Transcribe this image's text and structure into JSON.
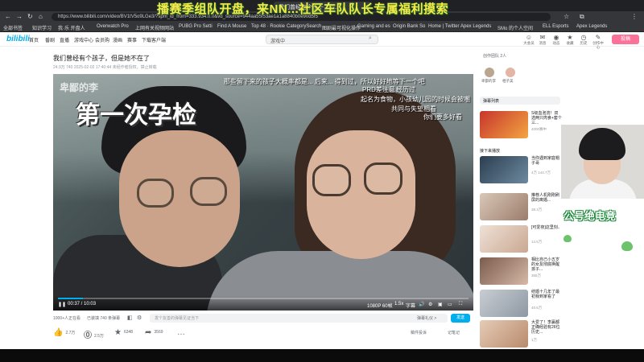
{
  "stream_banner": "播赛季组队开盘，来NN...社区车队队长专属福利摸索",
  "browser": {
    "tabs": [
      "",
      "",
      "",
      "我们曾经有个孩子，但..."
    ],
    "url": "https://www.bilibili.com/video/BV1tV5o9LGe3/?spm_id_from=333.934.0.0&vd_source=944aa55f53ae1a1a8840b0e90d5f5",
    "bookmarks": [
      "全部书签",
      "知识学习",
      "我·乐 开盘人",
      "Overwatch Pro",
      "上网有关视频网站",
      "PUBG Pro Setti",
      "Find A Mouse",
      "Top 48 · Rookie",
      "CategorySearch",
      "图剧最可视化操作",
      "Gaming and es",
      "Origin Bank So",
      "Home | Twitter",
      "Apex Legends",
      "SMo 的个人空间",
      "ELL Esports",
      "Apex Legends"
    ]
  },
  "site_header": {
    "logo": "bilibili",
    "nav": [
      "首页",
      "番剧",
      "直播",
      "游戏中心",
      "会员购",
      "漫画",
      "赛事",
      "下载客户端"
    ],
    "search_value": "游戏中",
    "icons": [
      {
        "glyph": "☺",
        "label": "大会员"
      },
      {
        "glyph": "✉",
        "label": "消息"
      },
      {
        "glyph": "◉",
        "label": "动态"
      },
      {
        "glyph": "★",
        "label": "收藏"
      },
      {
        "glyph": "◷",
        "label": "历史"
      },
      {
        "glyph": "✎",
        "label": "创作中心"
      }
    ],
    "upload_label": "投稿"
  },
  "video": {
    "title": "我们曾经有个孩子，但是她不在了",
    "meta": "24.9万  740  2025-02-02 17:40:44  未经作者授权，禁止转载",
    "caption": "第一次孕检",
    "brand": "卑鄙的李",
    "danmaku": [
      "那些留下来的孩子大概率都是... 后来... 得到过，所以好好地等下一个吧",
      "经历过",
      "PRD差注意",
      "起名为食物，小孩幼儿园的时候会被嘲",
      "共同与失望相看",
      "你们要多好看"
    ],
    "time": "00:37 / 10:03",
    "quality": "1080P 60帧",
    "speed": "1.5x",
    "subtitle_btn": "字幕",
    "progress_pct": 6
  },
  "danmaku_bar": {
    "viewers": "1000+人正在看",
    "loaded": "已装填 740 条弹幕",
    "placeholder": "发个友善的弹幕见证当下",
    "etiquette": "弹幕礼仪 >",
    "send": "发送"
  },
  "actions": {
    "like": "2.7万",
    "coin": "2.5万",
    "favorite": "6348",
    "share": "3569",
    "more": "…"
  },
  "right_actions": {
    "notes": "记笔记",
    "complaint": "稿件投诉"
  },
  "sidebar": {
    "up_header": "创作团队 2人",
    "up_names": [
      "卑鄙的李",
      "相子美"
    ],
    "list_header": "弹幕列表",
    "recommend_title": "接下来播放",
    "cards": [
      {
        "title": "S级血泡流！双选两只肉食+套个三...",
        "sub": "4000赛中"
      },
      {
        "title": "当你遇到家庭帽子哥",
        "sub": "4万  144.7万"
      },
      {
        "title": "推荐人机刚刚刷屏的离婚...",
        "sub": "38.3万"
      },
      {
        "title": "[可爱夜]这里刻..",
        "sub": "14.5万"
      },
      {
        "title": "相比自己小五岁的女友彻底唤醒孩子...",
        "sub": "365万"
      },
      {
        "title": "结婚十几年了最初我到家看了",
        "sub": "40.5万"
      },
      {
        "title": "大爱了！李赢都正确经验有26位历史...",
        "sub": "1万"
      }
    ]
  },
  "webcam_logo": "公号绝电竞",
  "colors": {
    "accent": "#00aeec",
    "pink": "#fb7299",
    "banner": "#f7e94a"
  }
}
